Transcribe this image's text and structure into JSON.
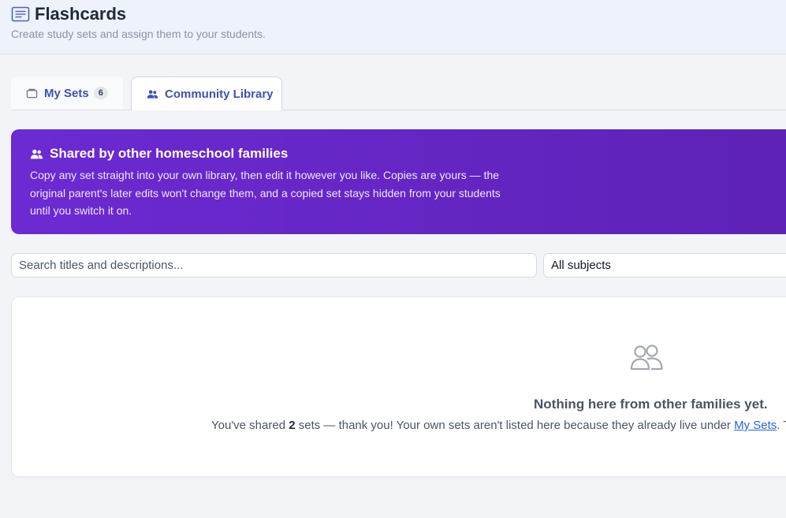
{
  "header": {
    "title": "Flashcards",
    "subtitle": "Create study sets and assign them to your students."
  },
  "tabs": {
    "my_sets": {
      "label": "My Sets",
      "count": "6"
    },
    "community": {
      "label": "Community Library"
    }
  },
  "banner": {
    "title": "Shared by other homeschool families",
    "text": "Copy any set straight into your own library, then edit it however you like. Copies are yours — the original parent's later edits won't change them, and a copied set stays hidden from your students until you switch it on."
  },
  "filters": {
    "search_placeholder": "Search titles and descriptions...",
    "subject_selected": "All subjects"
  },
  "empty_state": {
    "title": "Nothing here from other families yet.",
    "text_prefix": "You've shared ",
    "shared_count": "2",
    "text_middle": " sets — thank you! Your own sets aren't listed here because they already live under ",
    "link_label": "My Sets",
    "text_suffix": ". T"
  },
  "colors": {
    "accent": "#3f51b5",
    "banner_start": "#6c2ad3",
    "banner_end": "#5d22b5",
    "link": "#2563eb"
  },
  "icons": {
    "title": "flashcard-icon",
    "my_sets_tab": "folder-icon",
    "community_tab": "people-icon",
    "banner": "people-icon",
    "empty_state": "people-outline-icon"
  }
}
